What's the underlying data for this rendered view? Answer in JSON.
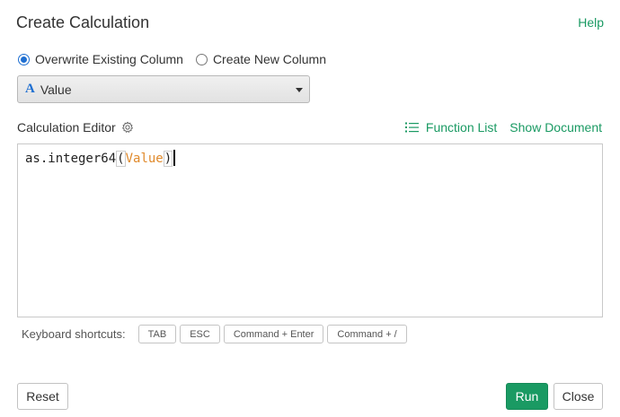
{
  "header": {
    "title": "Create Calculation",
    "help_label": "Help"
  },
  "mode": {
    "options": [
      {
        "label": "Overwrite Existing Column",
        "checked": true
      },
      {
        "label": "Create New Column",
        "checked": false
      }
    ]
  },
  "column_select": {
    "type_glyph": "A",
    "value": "Value"
  },
  "editor": {
    "label": "Calculation Editor",
    "function_list_label": "Function List",
    "show_document_label": "Show Document",
    "code": {
      "function": "as.integer64",
      "open_paren": "(",
      "argument": "Value",
      "close_paren": ")"
    }
  },
  "shortcuts": {
    "label": "Keyboard shortcuts:",
    "keys": [
      "TAB",
      "ESC",
      "Command + Enter",
      "Command + /"
    ]
  },
  "footer": {
    "reset_label": "Reset",
    "run_label": "Run",
    "close_label": "Close"
  },
  "colors": {
    "accent_green": "#1a9a63",
    "radio_blue": "#1f6fd1",
    "argument_orange": "#e08a2c"
  }
}
